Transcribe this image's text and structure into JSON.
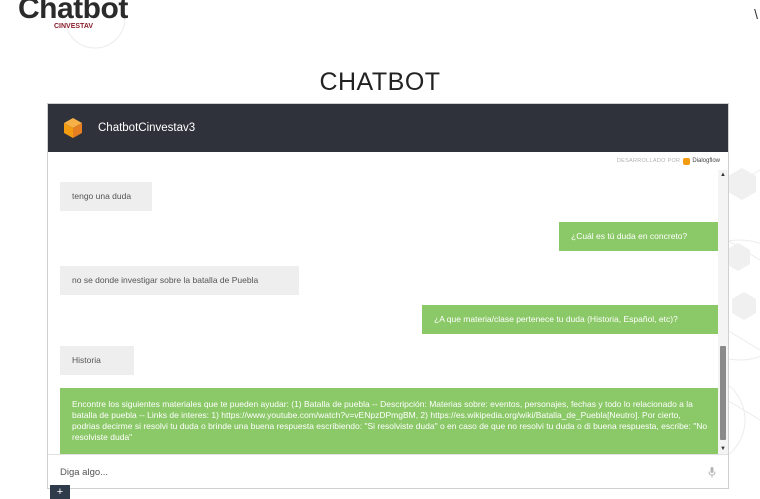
{
  "site": {
    "logo_text": "Chatbot",
    "logo_sub": "CINVESTAV",
    "corner_glyph": "\\"
  },
  "page_title": "CHATBOT",
  "chat": {
    "bot_name": "ChatbotCinvestav3",
    "powered_by": "DESARROLLADO POR",
    "powered_brand": "Dialogflow",
    "messages": [
      {
        "from": "user",
        "text": "tengo una duda"
      },
      {
        "from": "bot",
        "text": "¿Cuál es tú duda en concreto?"
      },
      {
        "from": "user",
        "text": "no se donde investigar sobre la batalla de Puebla"
      },
      {
        "from": "bot",
        "text": "¿A que materia/clase pertenece tu duda (Historia, Español, etc)?"
      },
      {
        "from": "user",
        "text": "Historia"
      },
      {
        "from": "bot",
        "text": "Encontre los siguientes materiales que te pueden ayudar: (1) Batalla de puebla -- Descripción: Materias sobre: eventos, personajes, fechas y todo lo relacionado a la batalla de puebla -- Links de interes: 1) https://www.youtube.com/watch?v=vENpzDPmgBM, 2) https://es.wikipedia.org/wiki/Batalla_de_Puebla[Neutro]. Por cierto, podrias decirme si resolvi tu duda o brinde una buena respuesta escribiendo: \"Si resolviste duda\" o en caso de que no resolvi tu duda o di buena respuesta, escribe: \"No resolviste duda\""
      }
    ],
    "input_placeholder": "Diga algo...",
    "input_value": ""
  },
  "colors": {
    "header_bg": "#2f323a",
    "bot_bubble": "#8bc867",
    "user_bubble": "#eeeeee",
    "avatar": "#f39c12"
  },
  "icons": {
    "bot_avatar": "orange-cube-icon",
    "mic": "microphone-icon",
    "fab": "plus-icon"
  },
  "fab_label": "+"
}
